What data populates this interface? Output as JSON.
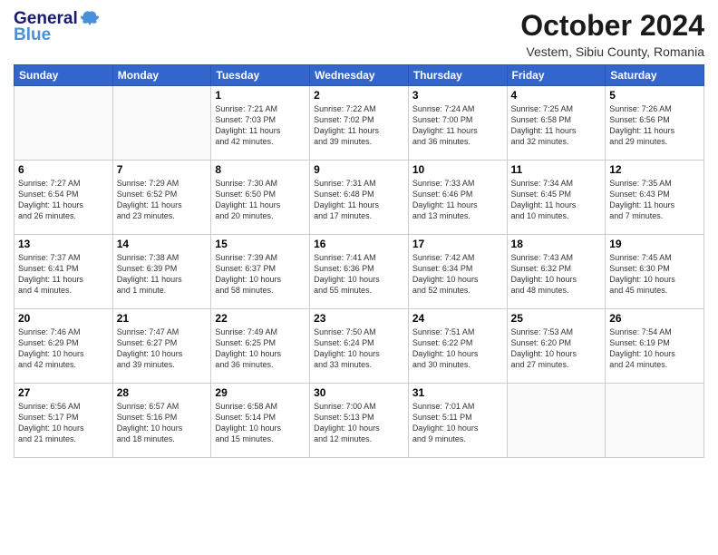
{
  "header": {
    "logo_general": "General",
    "logo_blue": "Blue",
    "month_title": "October 2024",
    "location": "Vestem, Sibiu County, Romania"
  },
  "weekdays": [
    "Sunday",
    "Monday",
    "Tuesday",
    "Wednesday",
    "Thursday",
    "Friday",
    "Saturday"
  ],
  "days": [
    {
      "num": "",
      "info": ""
    },
    {
      "num": "",
      "info": ""
    },
    {
      "num": "1",
      "info": "Sunrise: 7:21 AM\nSunset: 7:03 PM\nDaylight: 11 hours\nand 42 minutes."
    },
    {
      "num": "2",
      "info": "Sunrise: 7:22 AM\nSunset: 7:02 PM\nDaylight: 11 hours\nand 39 minutes."
    },
    {
      "num": "3",
      "info": "Sunrise: 7:24 AM\nSunset: 7:00 PM\nDaylight: 11 hours\nand 36 minutes."
    },
    {
      "num": "4",
      "info": "Sunrise: 7:25 AM\nSunset: 6:58 PM\nDaylight: 11 hours\nand 32 minutes."
    },
    {
      "num": "5",
      "info": "Sunrise: 7:26 AM\nSunset: 6:56 PM\nDaylight: 11 hours\nand 29 minutes."
    },
    {
      "num": "6",
      "info": "Sunrise: 7:27 AM\nSunset: 6:54 PM\nDaylight: 11 hours\nand 26 minutes."
    },
    {
      "num": "7",
      "info": "Sunrise: 7:29 AM\nSunset: 6:52 PM\nDaylight: 11 hours\nand 23 minutes."
    },
    {
      "num": "8",
      "info": "Sunrise: 7:30 AM\nSunset: 6:50 PM\nDaylight: 11 hours\nand 20 minutes."
    },
    {
      "num": "9",
      "info": "Sunrise: 7:31 AM\nSunset: 6:48 PM\nDaylight: 11 hours\nand 17 minutes."
    },
    {
      "num": "10",
      "info": "Sunrise: 7:33 AM\nSunset: 6:46 PM\nDaylight: 11 hours\nand 13 minutes."
    },
    {
      "num": "11",
      "info": "Sunrise: 7:34 AM\nSunset: 6:45 PM\nDaylight: 11 hours\nand 10 minutes."
    },
    {
      "num": "12",
      "info": "Sunrise: 7:35 AM\nSunset: 6:43 PM\nDaylight: 11 hours\nand 7 minutes."
    },
    {
      "num": "13",
      "info": "Sunrise: 7:37 AM\nSunset: 6:41 PM\nDaylight: 11 hours\nand 4 minutes."
    },
    {
      "num": "14",
      "info": "Sunrise: 7:38 AM\nSunset: 6:39 PM\nDaylight: 11 hours\nand 1 minute."
    },
    {
      "num": "15",
      "info": "Sunrise: 7:39 AM\nSunset: 6:37 PM\nDaylight: 10 hours\nand 58 minutes."
    },
    {
      "num": "16",
      "info": "Sunrise: 7:41 AM\nSunset: 6:36 PM\nDaylight: 10 hours\nand 55 minutes."
    },
    {
      "num": "17",
      "info": "Sunrise: 7:42 AM\nSunset: 6:34 PM\nDaylight: 10 hours\nand 52 minutes."
    },
    {
      "num": "18",
      "info": "Sunrise: 7:43 AM\nSunset: 6:32 PM\nDaylight: 10 hours\nand 48 minutes."
    },
    {
      "num": "19",
      "info": "Sunrise: 7:45 AM\nSunset: 6:30 PM\nDaylight: 10 hours\nand 45 minutes."
    },
    {
      "num": "20",
      "info": "Sunrise: 7:46 AM\nSunset: 6:29 PM\nDaylight: 10 hours\nand 42 minutes."
    },
    {
      "num": "21",
      "info": "Sunrise: 7:47 AM\nSunset: 6:27 PM\nDaylight: 10 hours\nand 39 minutes."
    },
    {
      "num": "22",
      "info": "Sunrise: 7:49 AM\nSunset: 6:25 PM\nDaylight: 10 hours\nand 36 minutes."
    },
    {
      "num": "23",
      "info": "Sunrise: 7:50 AM\nSunset: 6:24 PM\nDaylight: 10 hours\nand 33 minutes."
    },
    {
      "num": "24",
      "info": "Sunrise: 7:51 AM\nSunset: 6:22 PM\nDaylight: 10 hours\nand 30 minutes."
    },
    {
      "num": "25",
      "info": "Sunrise: 7:53 AM\nSunset: 6:20 PM\nDaylight: 10 hours\nand 27 minutes."
    },
    {
      "num": "26",
      "info": "Sunrise: 7:54 AM\nSunset: 6:19 PM\nDaylight: 10 hours\nand 24 minutes."
    },
    {
      "num": "27",
      "info": "Sunrise: 6:56 AM\nSunset: 5:17 PM\nDaylight: 10 hours\nand 21 minutes."
    },
    {
      "num": "28",
      "info": "Sunrise: 6:57 AM\nSunset: 5:16 PM\nDaylight: 10 hours\nand 18 minutes."
    },
    {
      "num": "29",
      "info": "Sunrise: 6:58 AM\nSunset: 5:14 PM\nDaylight: 10 hours\nand 15 minutes."
    },
    {
      "num": "30",
      "info": "Sunrise: 7:00 AM\nSunset: 5:13 PM\nDaylight: 10 hours\nand 12 minutes."
    },
    {
      "num": "31",
      "info": "Sunrise: 7:01 AM\nSunset: 5:11 PM\nDaylight: 10 hours\nand 9 minutes."
    },
    {
      "num": "",
      "info": ""
    },
    {
      "num": "",
      "info": ""
    }
  ]
}
